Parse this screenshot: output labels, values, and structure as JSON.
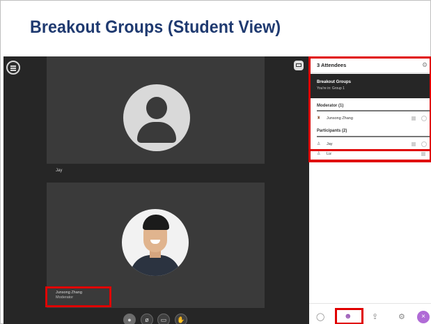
{
  "slide": {
    "title": "Breakout Groups (Student View)"
  },
  "video": {
    "tile1_name": "Jay",
    "tile2_name": "Junsong Zhang",
    "tile2_role": "Moderator"
  },
  "panel": {
    "attendees_title": "3 Attendees",
    "group_title": "Breakout Groups",
    "group_subtitle": "You're in: Group 1",
    "moderator_section": "Moderator (1)",
    "moderators": [
      "Junsong Zhang"
    ],
    "participants_section": "Participants (2)",
    "participants": [
      "Jay",
      "Liz"
    ]
  },
  "icons": {
    "menu": "menu-icon",
    "layout": "layout-icon",
    "settings": "gear-icon",
    "mic": "mic-muted-icon",
    "camera": "camera-off-icon",
    "hand": "hand-icon",
    "chat": "chat-icon",
    "attendees": "attendees-icon",
    "share": "share-icon",
    "session_settings": "settings-icon"
  },
  "colors": {
    "title": "#1f3a70",
    "highlight": "#e00000",
    "accent": "#b06bd6"
  }
}
